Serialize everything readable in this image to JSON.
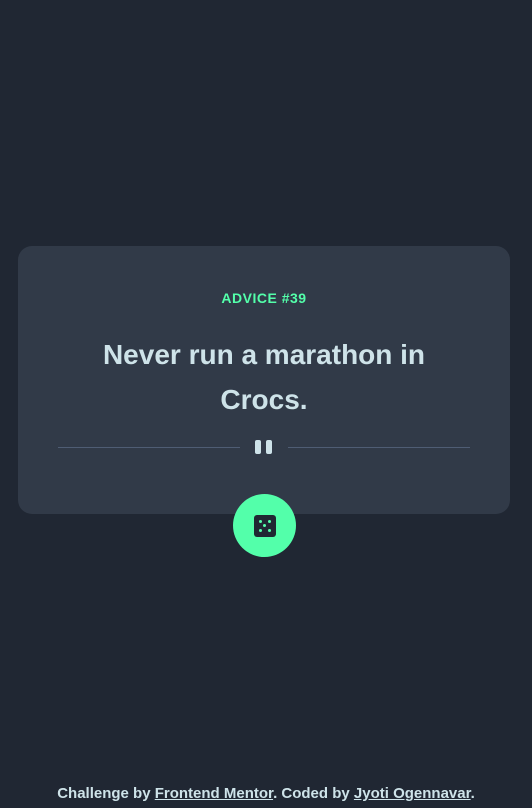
{
  "card": {
    "advice_id": "ADVICE #39",
    "advice_text": "Never run a marathon in Crocs."
  },
  "divider": {
    "icon": "pause-icon"
  },
  "dice_button": {
    "icon": "dice-icon"
  },
  "footer": {
    "prefix": "Challenge by ",
    "challenge_link": "Frontend Mentor",
    "middle": ". Coded by ",
    "author_link": "Jyoti Ogennavar",
    "suffix": "."
  },
  "colors": {
    "background": "#202733",
    "card": "#313A48",
    "accent": "#53FFAA",
    "text": "#CEE3E9",
    "divider": "#4F5D74"
  }
}
